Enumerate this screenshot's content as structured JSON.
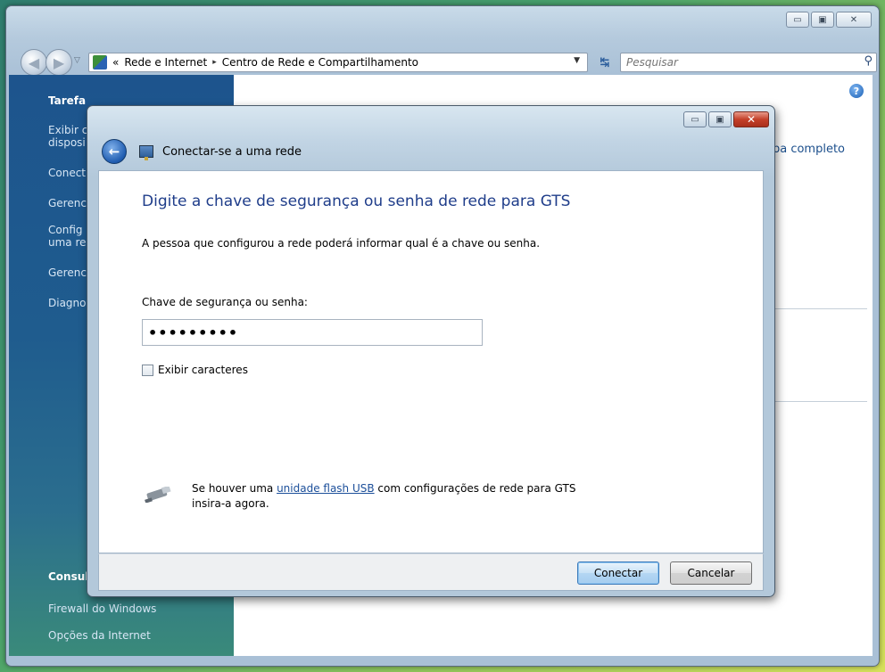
{
  "explorer": {
    "breadcrumb_overflow": "«",
    "breadcrumb_1": "Rede e Internet",
    "breadcrumb_sep": "▸",
    "breadcrumb_2": "Centro de Rede e Compartilhamento",
    "search_placeholder": "Pesquisar",
    "left_pane": {
      "heading_tasks": "Tarefa",
      "items": [
        "Exibir c",
        "disposi",
        "Conect",
        "Gerenc",
        "Config",
        "uma re",
        "Gerenc",
        "Diagno"
      ],
      "heading_see_also": "Consul",
      "links": [
        "Firewall do Windows",
        "Opções da Internet"
      ]
    },
    "right_pane": {
      "map_link": "apa completo"
    }
  },
  "dialog": {
    "title": "Conectar-se a uma rede",
    "heading": "Digite a chave de segurança ou senha de rede para GTS",
    "info": "A pessoa que configurou a rede poderá informar qual é a chave ou senha.",
    "field_label": "Chave de segurança ou senha:",
    "password_value": "•••••••••",
    "checkbox_label": "Exibir caracteres",
    "usb_text_before": "Se houver uma ",
    "usb_link": "unidade flash USB",
    "usb_text_after": " com configurações de rede para GTS",
    "usb_text_line2": "insira-a agora.",
    "connect_button": "Conectar",
    "cancel_button": "Cancelar"
  }
}
